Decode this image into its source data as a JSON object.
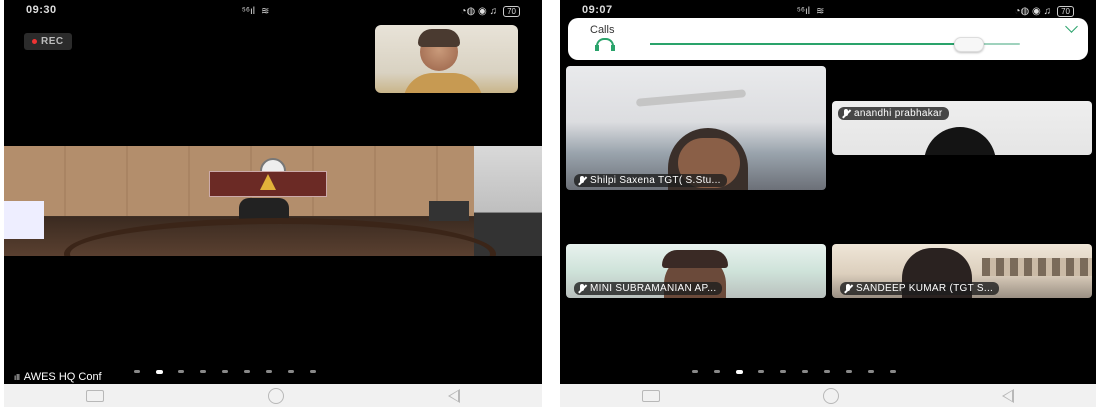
{
  "left_screen": {
    "status": {
      "time": "09:30",
      "signal": "⁵⁶ıl",
      "wifi": "≋",
      "icons": "◔◍ ◉ ♫",
      "battery": "70"
    },
    "rec_label": "REC",
    "room_name": "AWES HQ Conf",
    "signal_icon": "ıll",
    "page_dots": 9,
    "active_dot": 1
  },
  "right_screen": {
    "status": {
      "time": "09:07",
      "signal": "⁵⁶ıl",
      "wifi": "≋",
      "icons": "◔◍ ◉ ♫",
      "battery": "70"
    },
    "calls": {
      "title": "Calls",
      "volume_fraction": 0.86
    },
    "participants": [
      {
        "name": "Shilpi Saxena TGT( S.Stu..."
      },
      {
        "name": "anandhi prabhakar"
      },
      {
        "name": "MINI SUBRAMANIAN  AP..."
      },
      {
        "name": "SANDEEP KUMAR (TGT S..."
      }
    ],
    "page_dots": 10,
    "active_dot": 2
  },
  "colors": {
    "accent": "#2aa36b",
    "video_bg": "#000000",
    "rec_dot": "#e33333"
  }
}
